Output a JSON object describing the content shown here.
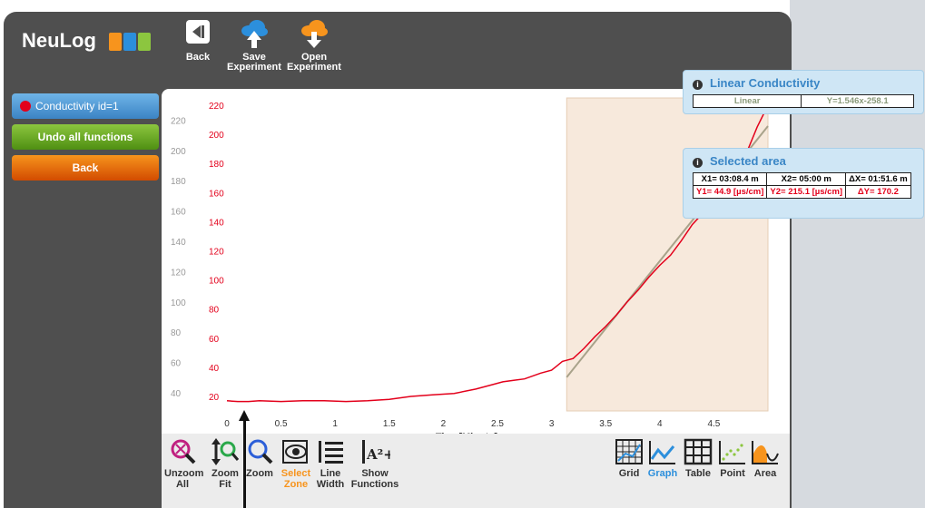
{
  "app": {
    "logo_text": "NeuLog",
    "logo_colors": [
      "#f7941d",
      "#2c8fdc",
      "#8cc63f"
    ]
  },
  "toolbar": {
    "back_label": "Back",
    "save_label_1": "Save",
    "save_label_2": "Experiment",
    "open_label_1": "Open",
    "open_label_2": "Experiment"
  },
  "sidebar": {
    "sensor_label": "Conductivity id=1",
    "undo_label": "Undo all functions",
    "back_label": "Back"
  },
  "linear_box": {
    "title": "Linear Conductivity",
    "type": "Linear",
    "equation": "Y=1.546x-258.1"
  },
  "selected_area": {
    "title": "Selected area",
    "x1": "X1= 03:08.4 m",
    "x2": "X2= 05:00 m",
    "dx": "ΔX= 01:51.6 m",
    "y1": "Y1= 44.9 [µs/cm]",
    "y2": "Y2= 215.1 [µs/cm]",
    "dy": "ΔY= 170.2"
  },
  "bottom_tools": {
    "unzoom_1": "Unzoom",
    "unzoom_2": "All",
    "zoomfit_1": "Zoom",
    "zoomfit_2": "Fit",
    "zoom": "Zoom",
    "select_1": "Select",
    "select_2": "Zone",
    "linewidth_1": "Line",
    "linewidth_2": "Width",
    "show_1": "Show",
    "show_2": "Functions",
    "show_icon_text": "A²+3",
    "grid": "Grid",
    "graph": "Graph",
    "table": "Table",
    "point": "Point",
    "area": "Area"
  },
  "colors": {
    "series": "#e3001b",
    "fit_line": "#a8a28a",
    "selection_fill": "#f7e9dc",
    "accent_orange": "#f7941d",
    "accent_blue": "#2c8fdc"
  },
  "chart_data": {
    "type": "line",
    "xlabel": "Time[Minute]",
    "x_ticks": [
      "0",
      "0.5",
      "1",
      "1.5",
      "2",
      "2.5",
      "3",
      "3.5",
      "4",
      "4.5"
    ],
    "xlim": [
      0,
      5
    ],
    "y_ticks_red": [
      "20",
      "40",
      "60",
      "80",
      "100",
      "120",
      "140",
      "160",
      "180",
      "200",
      "220"
    ],
    "ylim_red": [
      10,
      225
    ],
    "y_ticks_grey": [
      "40",
      "60",
      "80",
      "100",
      "120",
      "140",
      "160",
      "180",
      "200",
      "220"
    ],
    "series": [
      {
        "name": "Conductivity id=1",
        "color": "#e3001b",
        "x": [
          0,
          0.1,
          0.2,
          0.3,
          0.5,
          0.7,
          0.9,
          1.1,
          1.3,
          1.5,
          1.7,
          1.9,
          2.1,
          2.3,
          2.45,
          2.55,
          2.65,
          2.75,
          2.9,
          3.0,
          3.05,
          3.1,
          3.15,
          3.2,
          3.3,
          3.4,
          3.5,
          3.6,
          3.7,
          3.8,
          3.9,
          4.0,
          4.1,
          4.2,
          4.3,
          4.4,
          4.5,
          4.6,
          4.7,
          4.8,
          4.9,
          5.0
        ],
        "y": [
          17,
          16.5,
          16.5,
          17,
          16.5,
          17,
          17,
          16.5,
          17,
          18,
          20,
          21,
          22,
          25,
          28,
          30,
          31,
          32,
          36,
          38,
          41,
          44,
          45,
          46,
          53,
          61,
          68,
          76,
          85,
          93,
          102,
          110,
          117,
          127,
          138,
          146,
          156,
          166,
          175,
          187,
          205,
          220
        ]
      }
    ],
    "fit": {
      "slope": 1.546,
      "intercept": -258.1,
      "x_unit_scale": 60,
      "xrange": [
        3.14,
        5.0
      ]
    },
    "selection": {
      "x1": 3.14,
      "x2": 5.0
    }
  }
}
